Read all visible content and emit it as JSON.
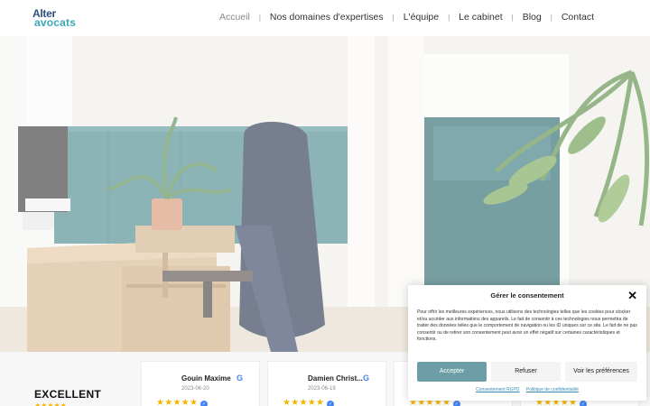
{
  "logo": {
    "line1": "Alter",
    "line2": "avocats"
  },
  "nav": {
    "items": [
      {
        "label": "Accueil",
        "active": true
      },
      {
        "label": "Nos domaines d'expertises",
        "active": false
      },
      {
        "label": "L'équipe",
        "active": false
      },
      {
        "label": "Le cabinet",
        "active": false
      },
      {
        "label": "Blog",
        "active": false
      },
      {
        "label": "Contact",
        "active": false
      }
    ],
    "separator": "|"
  },
  "reviews": {
    "rating_label": "EXCELLENT",
    "rating_stars": "★★★★★",
    "cards": [
      {
        "name": "Gouin Maxime",
        "date": "2023-06-20",
        "stars": "★★★★★"
      },
      {
        "name": "Damien Christ...",
        "date": "2023-06-19",
        "stars": "★★★★★"
      },
      {
        "name": "",
        "date": "",
        "stars": "★★★★★"
      },
      {
        "name": "",
        "date": "",
        "stars": "★★★★★"
      }
    ]
  },
  "consent": {
    "title": "Gérer le consentement",
    "close": "✕",
    "text": "Pour offrir les meilleures expériences, nous utilisons des technologies telles que les cookies pour stocker et/ou accéder aux informations des appareils. Le fait de consentir à ces technologies nous permettra de traiter des données telles que le comportement de navigation ou les ID uniques sur ce site. Le fait de ne pas consentir ou de retirer son consentement peut avoir un effet négatif sur certaines caractéristiques et fonctions.",
    "accept": "Accepter",
    "refuse": "Refuser",
    "preferences": "Voir les préférences",
    "link1": "Consentement RGPD",
    "link2": "Politique de confidentialité"
  },
  "colors": {
    "brand_blue": "#2c4f7c",
    "brand_teal": "#3aa8b6",
    "accept_button": "#6d9ea8",
    "star": "#f5b400"
  }
}
